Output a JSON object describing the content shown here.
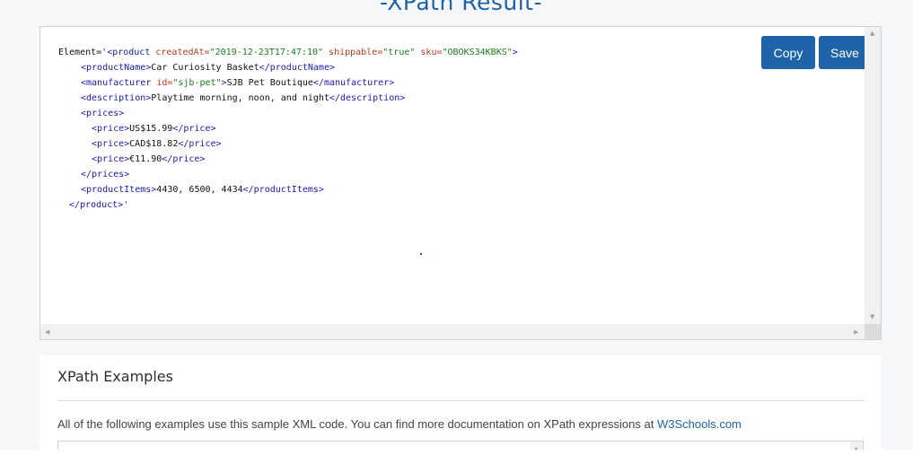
{
  "page": {
    "title": "-XPath Result-"
  },
  "result": {
    "copy_label": "Copy",
    "save_label": "Save",
    "lines": {
      "l1_prefix": "Element='",
      "l1_tag_open": "<product ",
      "l1_attr1": "createdAt=",
      "l1_val1": "\"2019-12-23T17:47:10\"",
      "l1_attr2": " shippable=",
      "l1_val2": "\"true\"",
      "l1_attr3": " sku=",
      "l1_val3": "\"OBOKS34KBKS\"",
      "l1_tag_close": ">",
      "l2_open": "<productName>",
      "l2_text": "Car Curiosity Basket",
      "l2_close": "</productName>",
      "l3_open": "<manufacturer ",
      "l3_attr": "id=",
      "l3_val": "\"sjb-pet\"",
      "l3_gt": ">",
      "l3_text": "SJB Pet Boutique",
      "l3_close": "</manufacturer>",
      "l4_open": "<description>",
      "l4_text": "Playtime morning, noon, and night",
      "l4_close": "</description>",
      "l5_open": "<prices>",
      "l6_open": "<price>",
      "l6_text": "US$15.99",
      "l6_close": "</price>",
      "l7_open": "<price>",
      "l7_text": "CAD$18.82",
      "l7_close": "</price>",
      "l8_open": "<price>",
      "l8_text": "€11.90",
      "l8_close": "</price>",
      "l9_close": "</prices>",
      "l10_open": "<productItems>",
      "l10_text": "4430, 6500, 4434",
      "l10_close": "</productItems>",
      "l11_close": "</product>",
      "l11_suffix": "'"
    }
  },
  "examples": {
    "title": "XPath Examples",
    "description": "All of the following examples use this sample XML code. You can find more documentation on XPath expressions at ",
    "link_text": "W3Schools.com"
  },
  "colors": {
    "accent": "#1f64a8",
    "tag": "#1a1ab0",
    "attribute": "#b83c1d",
    "value": "#1b7d1b"
  }
}
